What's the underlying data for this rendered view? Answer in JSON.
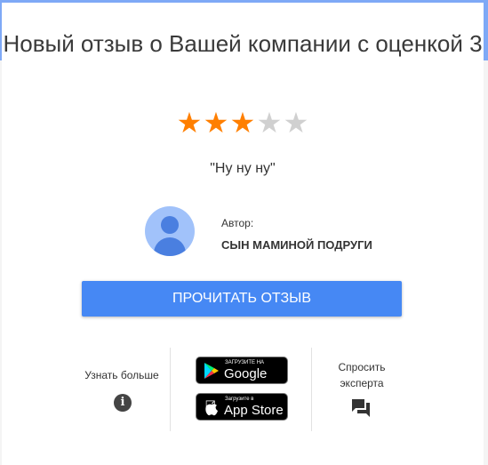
{
  "title": "Новый отзыв о Вашей компании с оценкой 3",
  "rating": {
    "value": 3,
    "max": 5,
    "filled_color": "#ff7f00",
    "empty_color": "#d0d0d0"
  },
  "quote": "\"Ну ну ну\"",
  "author": {
    "label": "Автор:",
    "name": "СЫН МАМИНОЙ ПОДРУГИ"
  },
  "read_button": "ПРОЧИТАТЬ ОТЗЫВ",
  "footer": {
    "learn_more": "Узнать больше",
    "google_play": {
      "small": "ЗАГРУЗИТЕ НА",
      "big": "Google Play"
    },
    "app_store": {
      "small": "Загрузите в",
      "big": "App Store"
    },
    "ask_expert": [
      "Спросить",
      "эксперта"
    ]
  },
  "colors": {
    "accent": "#4688f4",
    "band": "#7ea9f6"
  }
}
